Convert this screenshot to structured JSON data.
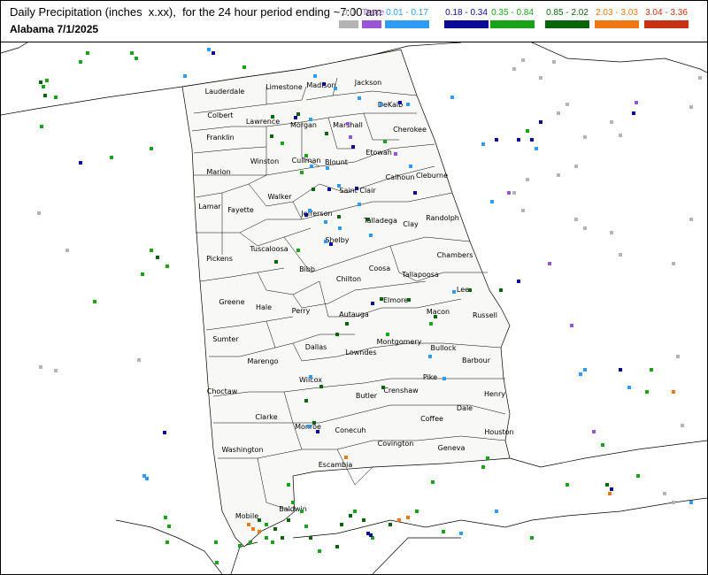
{
  "header": {
    "title": "Daily Precipitation (inches  x.xx),  for the 24 hour period ending ~7:00 am",
    "subtitle": "Alabama 7/1/2025"
  },
  "legend": [
    {
      "label": "0.0",
      "color": "#b4b4b4",
      "text_color": "#9a9a9a"
    },
    {
      "label": "Trace",
      "color": "#9a55d6",
      "text_color": "#9a55d6"
    },
    {
      "label": "0.01 - 0.17",
      "color": "#2e9bf4",
      "text_color": "#2e9bf4"
    },
    {
      "label": "0.18 - 0.34",
      "color": "#0a0a96",
      "text_color": "#0a0a96"
    },
    {
      "label": "0.35 - 0.84",
      "color": "#1aa21a",
      "text_color": "#1aa21a"
    },
    {
      "label": "0.85 - 2.02",
      "color": "#0a640a",
      "text_color": "#0a640a"
    },
    {
      "label": "2.03 - 3.03",
      "color": "#f07814",
      "text_color": "#f07814"
    },
    {
      "label": "3.04 - 3.36",
      "color": "#c83214",
      "text_color": "#c83214"
    }
  ],
  "counties": [
    {
      "name": "Lauderdale"
    },
    {
      "name": "Limestone"
    },
    {
      "name": "Madison"
    },
    {
      "name": "Jackson"
    },
    {
      "name": "Colbert"
    },
    {
      "name": "Lawrence"
    },
    {
      "name": "Morgan"
    },
    {
      "name": "Marshall"
    },
    {
      "name": "DeKalb"
    },
    {
      "name": "Franklin"
    },
    {
      "name": "Cherokee"
    },
    {
      "name": "Marion"
    },
    {
      "name": "Winston"
    },
    {
      "name": "Cullman"
    },
    {
      "name": "Blount"
    },
    {
      "name": "Etowah"
    },
    {
      "name": "Calhoun"
    },
    {
      "name": "Cleburne"
    },
    {
      "name": "Lamar"
    },
    {
      "name": "Fayette"
    },
    {
      "name": "Walker"
    },
    {
      "name": "Jefferson"
    },
    {
      "name": "Saint Clair"
    },
    {
      "name": "Talladega"
    },
    {
      "name": "Clay"
    },
    {
      "name": "Randolph"
    },
    {
      "name": "Pickens"
    },
    {
      "name": "Tuscaloosa"
    },
    {
      "name": "Shelby"
    },
    {
      "name": "Bibb"
    },
    {
      "name": "Coosa"
    },
    {
      "name": "Tallapoosa"
    },
    {
      "name": "Chambers"
    },
    {
      "name": "Chilton"
    },
    {
      "name": "Greene"
    },
    {
      "name": "Hale"
    },
    {
      "name": "Perry"
    },
    {
      "name": "Autauga"
    },
    {
      "name": "Elmore"
    },
    {
      "name": "Lee"
    },
    {
      "name": "Macon"
    },
    {
      "name": "Russell"
    },
    {
      "name": "Sumter"
    },
    {
      "name": "Dallas"
    },
    {
      "name": "Montgomery"
    },
    {
      "name": "Lowndes"
    },
    {
      "name": "Bullock"
    },
    {
      "name": "Marengo"
    },
    {
      "name": "Barbour"
    },
    {
      "name": "Choctaw"
    },
    {
      "name": "Wilcox"
    },
    {
      "name": "Pike"
    },
    {
      "name": "Butler"
    },
    {
      "name": "Crenshaw"
    },
    {
      "name": "Henry"
    },
    {
      "name": "Clarke"
    },
    {
      "name": "Dale"
    },
    {
      "name": "Coffee"
    },
    {
      "name": "Monroe"
    },
    {
      "name": "Conecuh"
    },
    {
      "name": "Washington"
    },
    {
      "name": "Houston"
    },
    {
      "name": "Covington"
    },
    {
      "name": "Geneva"
    },
    {
      "name": "Escambia"
    },
    {
      "name": "Mobile"
    },
    {
      "name": "Baldwin"
    }
  ]
}
